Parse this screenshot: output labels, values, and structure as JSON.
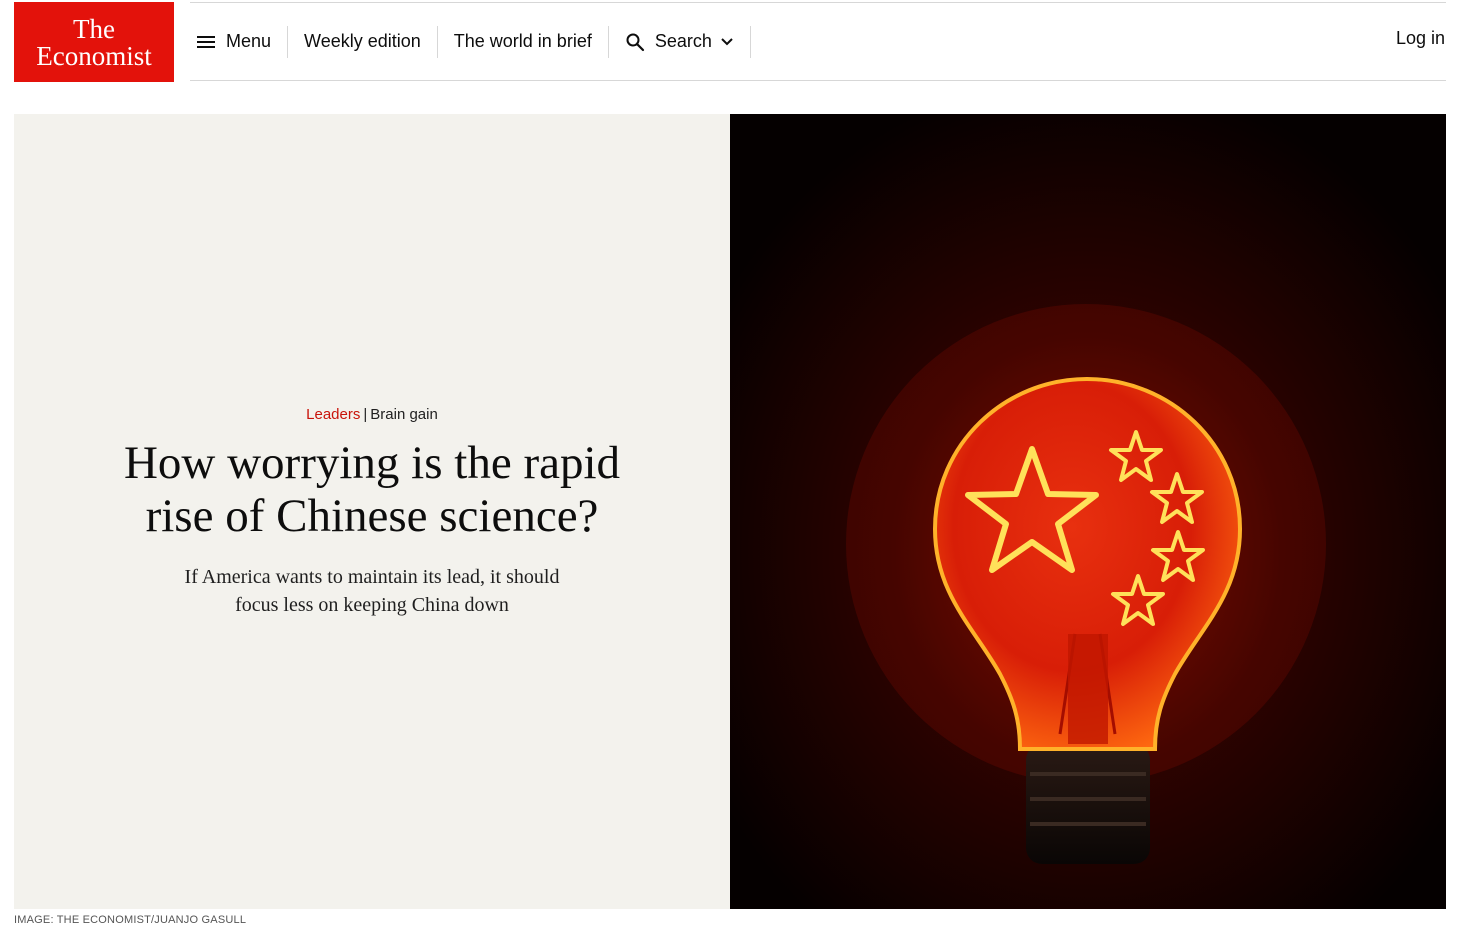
{
  "brand": {
    "logo_line1": "The",
    "logo_line2": "Economist",
    "color": "#e3120b"
  },
  "nav": {
    "menu_label": "Menu",
    "weekly_label": "Weekly edition",
    "brief_label": "The world in brief",
    "search_label": "Search",
    "login_label": "Log in"
  },
  "article": {
    "section": "Leaders",
    "separator": "|",
    "flytitle": "Brain gain",
    "headline": "How worrying is the rapid rise of Chinese science?",
    "standfirst": "If America wants to maintain its lead, it should focus less on keeping China down"
  },
  "image": {
    "caption": "IMAGE: THE ECONOMIST/JUANJO GASULL",
    "subject": "light-bulb-with-chinese-flag-stars"
  },
  "icons": {
    "menu": "hamburger-icon",
    "search": "magnifier-icon",
    "dropdown": "chevron-down-icon"
  }
}
